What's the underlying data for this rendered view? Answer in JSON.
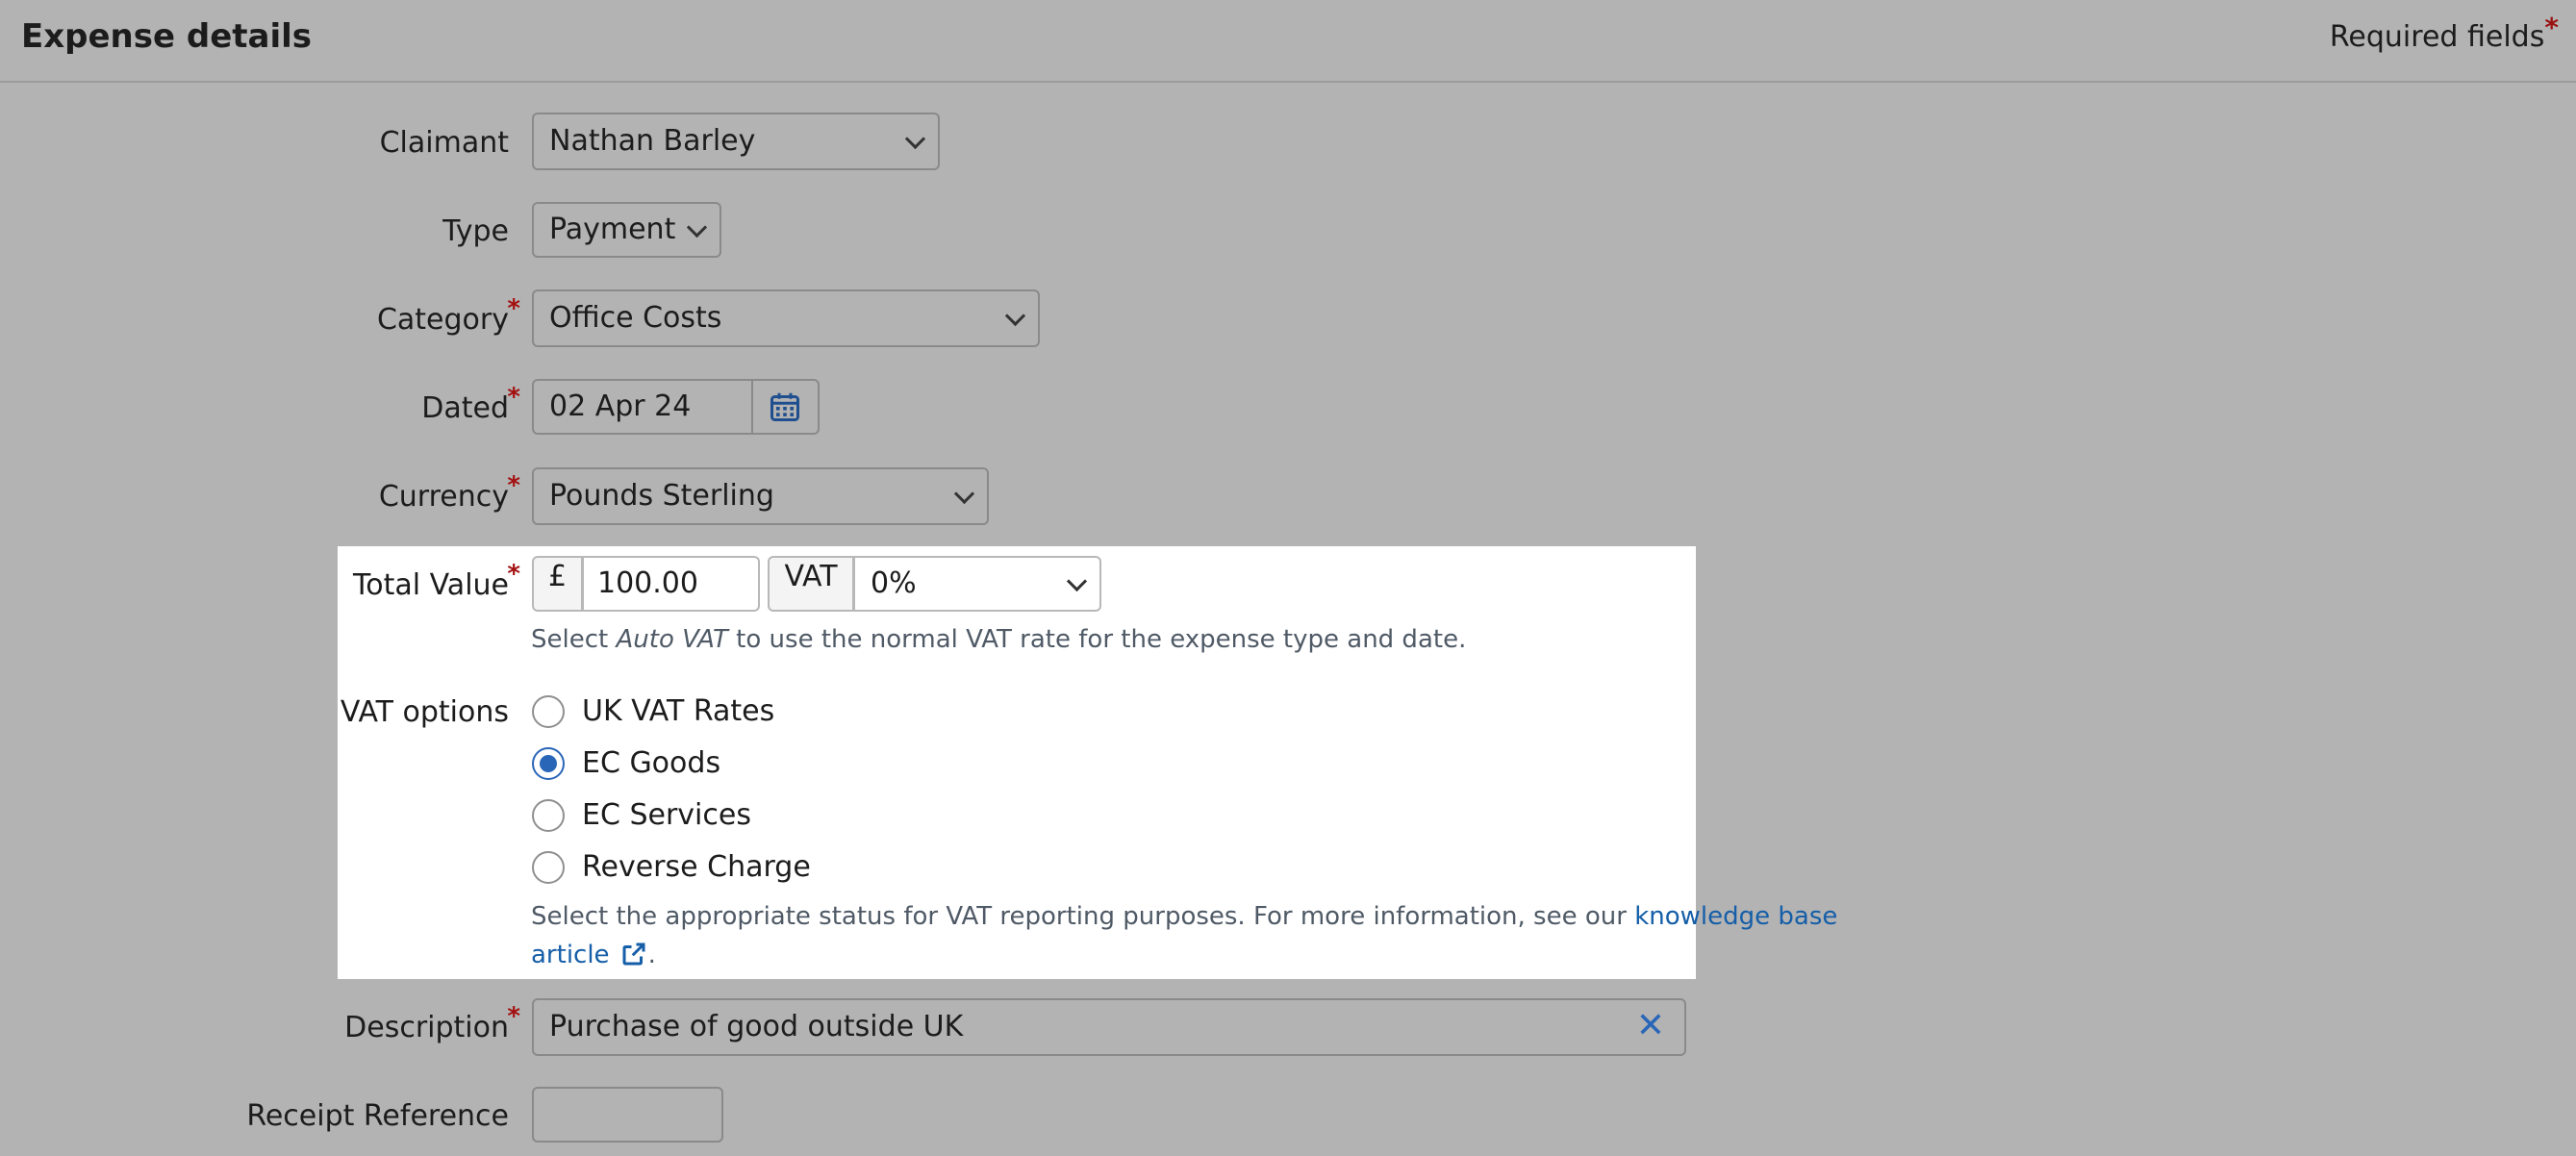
{
  "header": {
    "title": "Expense details",
    "required_label": "Required fields",
    "required_marker": "*"
  },
  "form": {
    "claimant": {
      "label": "Claimant",
      "value": "Nathan Barley"
    },
    "type": {
      "label": "Type",
      "value": "Payment"
    },
    "category": {
      "label": "Category",
      "value": "Office Costs",
      "required": "*"
    },
    "dated": {
      "label": "Dated",
      "value": "02 Apr 24",
      "required": "*"
    },
    "currency": {
      "label": "Currency",
      "value": "Pounds Sterling",
      "required": "*"
    },
    "total_value": {
      "label": "Total Value",
      "required": "*",
      "currency_symbol": "£",
      "amount": "100.00",
      "vat_label": "VAT",
      "vat_rate": "0%",
      "hint_prefix": "Select ",
      "hint_em": "Auto VAT",
      "hint_suffix": " to use the normal VAT rate for the expense type and date."
    },
    "vat_options": {
      "label": "VAT options",
      "options": [
        "UK VAT Rates",
        "EC Goods",
        "EC Services",
        "Reverse Charge"
      ],
      "selected": "EC Goods",
      "hint_text": "Select the appropriate status for VAT reporting purposes. For more information, see our ",
      "link_part1": "knowledge base",
      "link_part2": "article",
      "hint_end": "."
    },
    "description": {
      "label": "Description",
      "value": "Purchase of good outside UK",
      "required": "*"
    },
    "receipt_reference": {
      "label": "Receipt Reference",
      "value": ""
    }
  },
  "colors": {
    "page_bg": "#b3b3b3",
    "highlight_bg": "#ffffff",
    "accent": "#2a66b8",
    "required": "#a31111",
    "link": "#155ea8"
  }
}
